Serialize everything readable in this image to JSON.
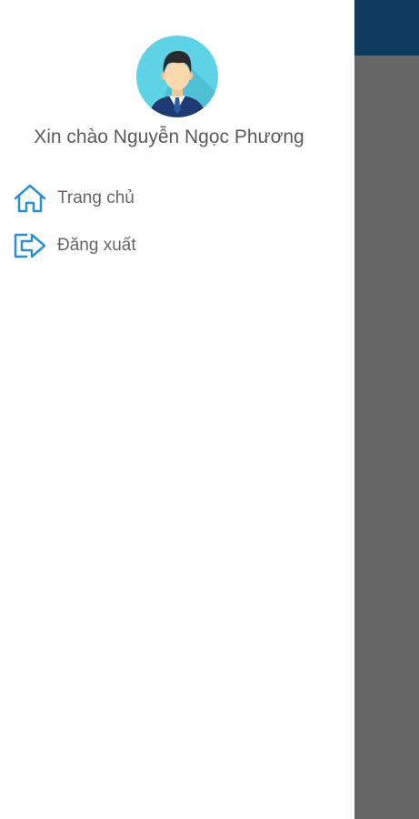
{
  "drawer": {
    "greeting": "Xin chào Nguyễn Ngọc Phương",
    "items": [
      {
        "label": "Trang chủ",
        "icon": "home-icon"
      },
      {
        "label": "Đăng xuất",
        "icon": "logout-icon"
      }
    ]
  },
  "colors": {
    "accent": "#2b8fd6",
    "scrim": "#666666",
    "app_bar_dimmed": "#0e3b5e",
    "avatar_bg": "#5fd3e6",
    "text": "#666666"
  }
}
